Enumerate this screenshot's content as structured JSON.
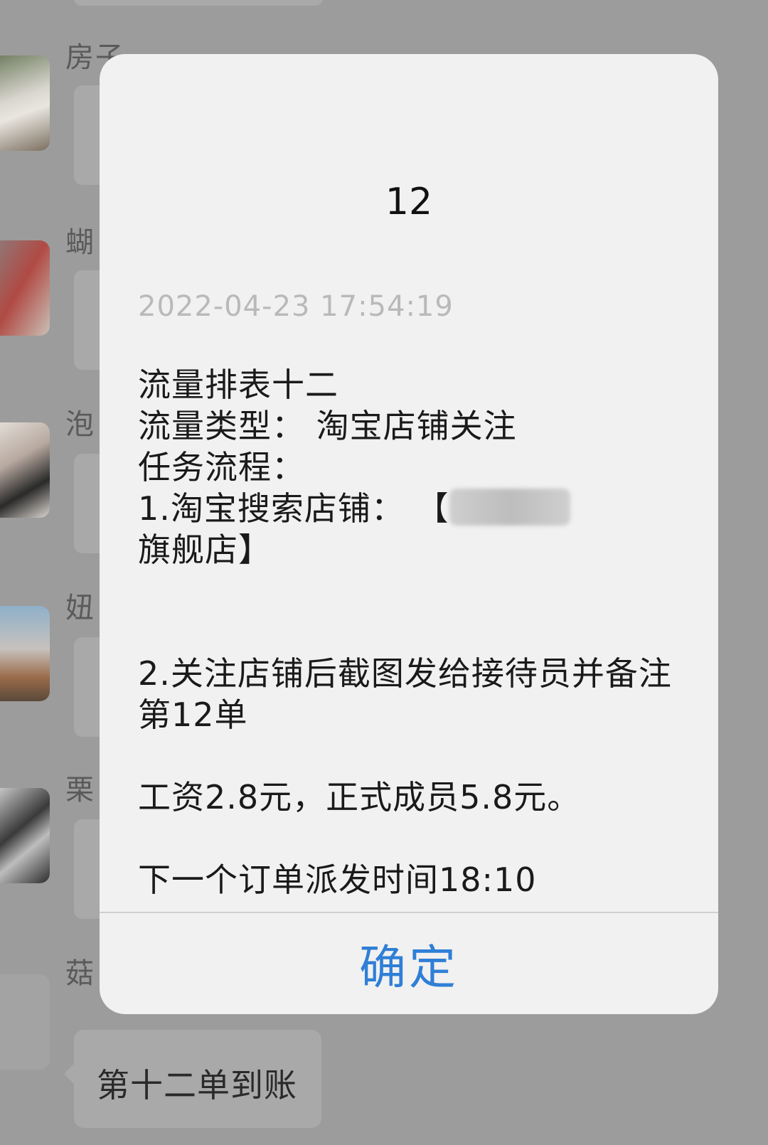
{
  "chat": {
    "senders": [
      "房子",
      "蝴",
      "泡",
      "妞",
      "栗",
      "菇"
    ],
    "last_message": "第十二单到账"
  },
  "dialog": {
    "title": "12",
    "timestamp": "2022-04-23 17:54:19",
    "lines": {
      "l1": "流量排表十二",
      "l2": "流量类型： 淘宝店铺关注",
      "l3": "任务流程：",
      "l4a": "1.淘宝搜索店铺： 【",
      "l4b": "旗舰店】",
      "l5": "2.关注店铺后截图发给接待员并备注第12单",
      "l6": "工资2.8元，正式成员5.8元。",
      "l7": "下一个订单派发时间18:10"
    },
    "confirm_label": "确定"
  }
}
